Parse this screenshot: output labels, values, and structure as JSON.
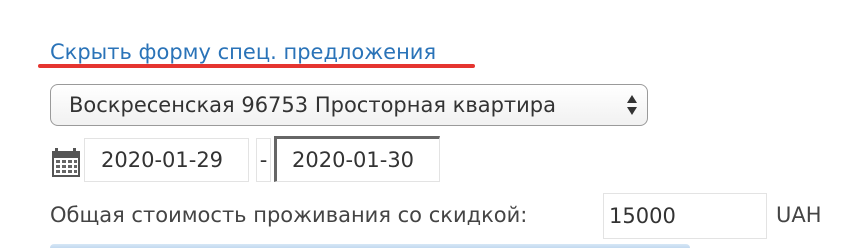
{
  "special_offer": {
    "toggle_link_label": "Скрыть форму спец. предложения"
  },
  "apartment": {
    "selected": "Воскресенская 96753 Просторная квартира"
  },
  "dates": {
    "from": "2020-01-29",
    "separator": "-",
    "to": "2020-01-30"
  },
  "cost": {
    "label": "Общая стоимость проживания со скидкой:",
    "value": "15000",
    "currency": "UAH"
  },
  "colors": {
    "link": "#2a73b8",
    "highlight_underline": "#e53530"
  },
  "icons": {
    "calendar": "calendar-icon",
    "select_arrows": "select-updown-arrows-icon"
  }
}
